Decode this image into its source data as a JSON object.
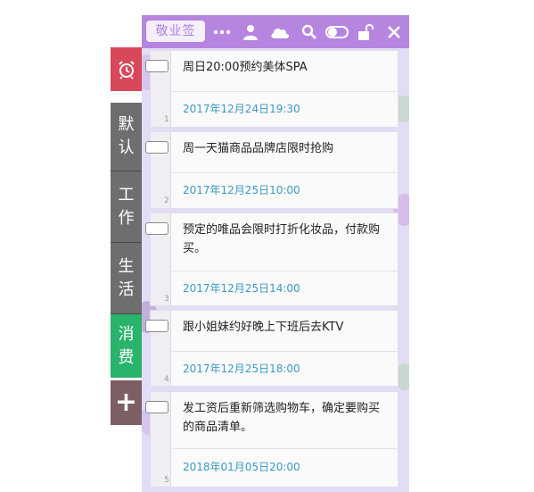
{
  "app": {
    "brand_label": "敬业签"
  },
  "toolbar": {
    "icons": [
      "more-icon",
      "user-icon",
      "cloud-icon",
      "search-icon",
      "toggle-icon",
      "unlock-icon",
      "close-icon"
    ]
  },
  "sidebar": {
    "alarm_icon": "alarm-clock-icon",
    "tabs": [
      {
        "label_top": "默",
        "label_bottom": "认"
      },
      {
        "label_top": "工",
        "label_bottom": "作"
      },
      {
        "label_top": "生",
        "label_bottom": "活"
      },
      {
        "label_top": "消",
        "label_bottom": "费"
      }
    ],
    "add_label": "+"
  },
  "notes": [
    {
      "index": "1",
      "text": "周日20:00预约美体SPA",
      "reminder": "2017年12月24日19:30"
    },
    {
      "index": "2",
      "text": "周一天猫商品品牌店限时抢购",
      "reminder": "2017年12月25日10:00"
    },
    {
      "index": "3",
      "text": "预定的唯品会限时打折化妆品，付款购买。",
      "reminder": "2017年12月25日14:00"
    },
    {
      "index": "4",
      "text": "跟小姐妹约好晚上下班后去KTV",
      "reminder": "2017年12月25日18:00"
    },
    {
      "index": "5",
      "text": "发工资后重新筛选购物车，确定要购买的商品清单。",
      "reminder": "2018年01月05日20:00"
    }
  ],
  "colors": {
    "topbar": "#b585e0",
    "alarm_tab": "#d9475a",
    "category_tab": "#6e6e6e",
    "active_tab": "#2ab36b",
    "date_text": "#3a9ac2"
  }
}
